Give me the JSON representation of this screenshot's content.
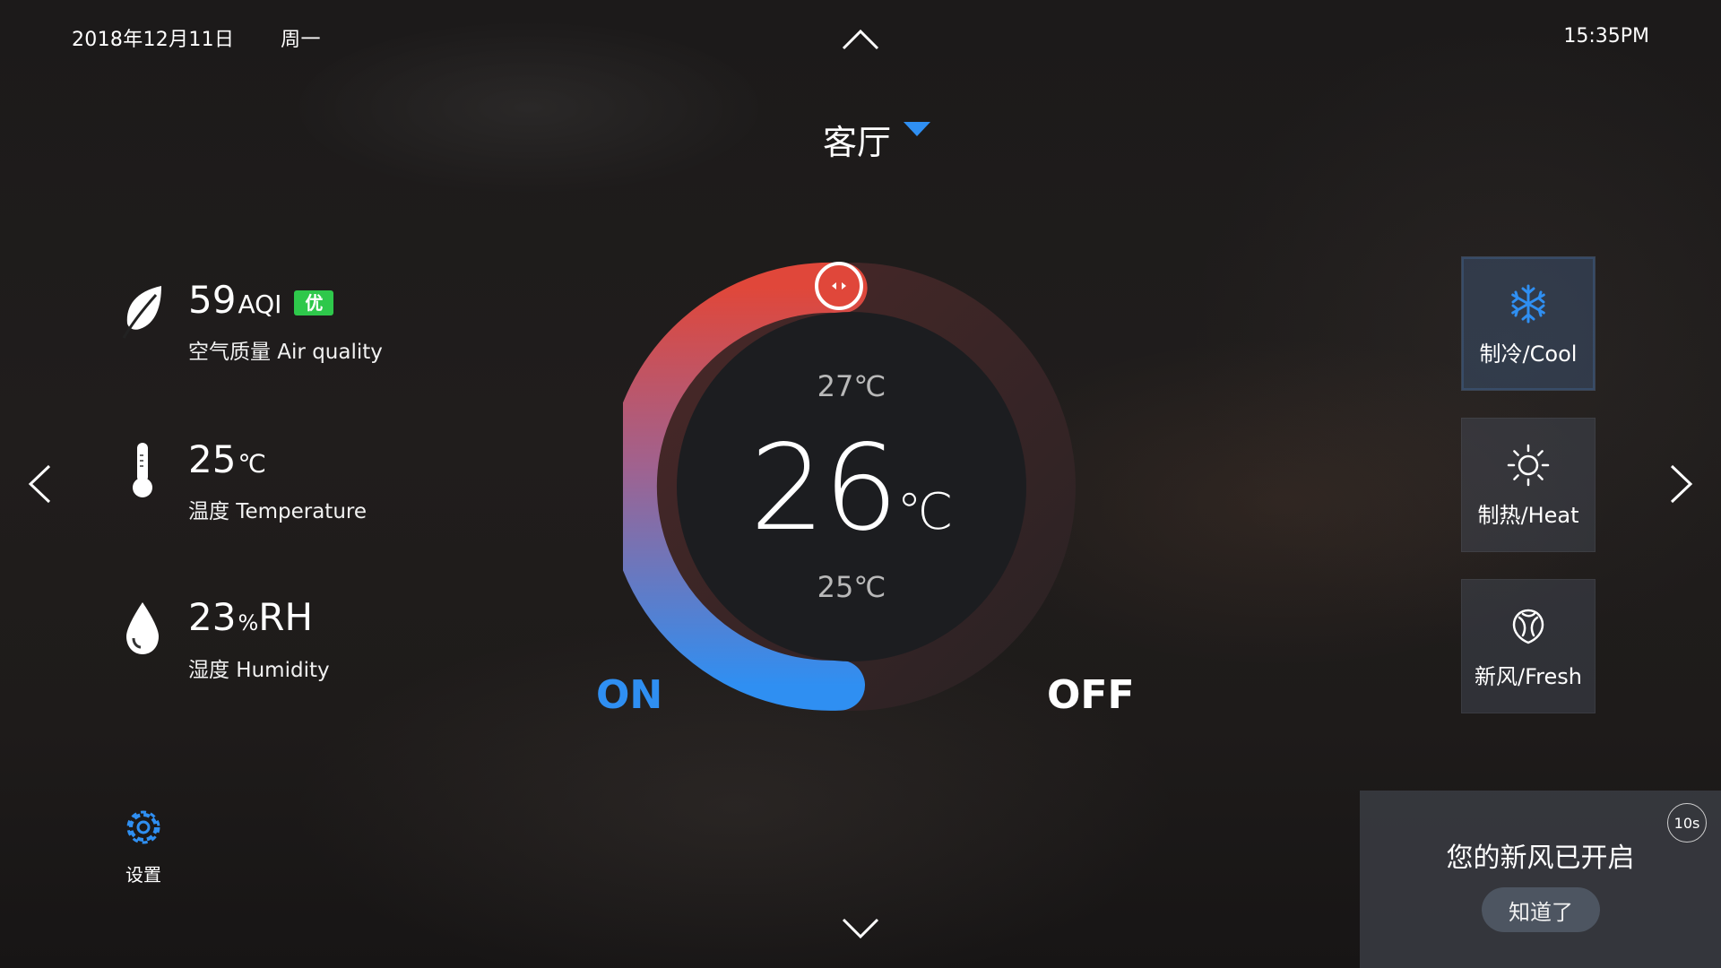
{
  "header": {
    "date": "2018年12月11日",
    "weekday": "周一",
    "time": "15:35PM",
    "room": "客厅",
    "icons": [
      "chevron-up-icon",
      "chevron-down-icon",
      "caret-down-icon"
    ]
  },
  "info": {
    "air": {
      "value": "59",
      "unit": "AQI",
      "badge": "优",
      "label": "空气质量 Air quality",
      "icon": "leaf-icon",
      "badge_color": "#2ec84b"
    },
    "temp": {
      "value": "25",
      "unit": "℃",
      "label": "温度 Temperature",
      "icon": "thermometer-icon"
    },
    "humidity": {
      "value": "23",
      "unit_pct": "%",
      "unit": "RH",
      "label": "湿度 Humidity",
      "icon": "water-drop-icon"
    }
  },
  "thermostat": {
    "current": "26",
    "unit": "℃",
    "upper": "27℃",
    "lower": "25℃",
    "on_label": "ON",
    "off_label": "OFF",
    "colors": {
      "cool": "#2f8ff2",
      "warm": "#e0473a"
    }
  },
  "modes": [
    {
      "label": "制冷/Cool",
      "icon": "snowflake-icon",
      "active": true
    },
    {
      "label": "制热/Heat",
      "icon": "sun-icon",
      "active": false
    },
    {
      "label": "新风/Fresh",
      "icon": "fresh-air-icon",
      "active": false
    }
  ],
  "settings": {
    "label": "设置",
    "icon": "gear-icon"
  },
  "toast": {
    "message": "您的新风已开启",
    "button": "知道了",
    "countdown": "10s"
  }
}
